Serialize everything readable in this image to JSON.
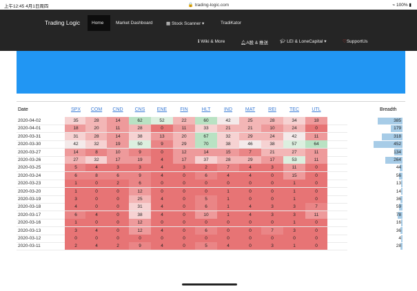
{
  "status_bar": {
    "time": "上午12:45",
    "date": "4月1日周四",
    "url": "trading-logic.com",
    "battery": "100%"
  },
  "nav": {
    "brand": "Trading Logic",
    "items": [
      "Home",
      "Market Dashboard",
      "Stock Scanner ▾",
      "TradiKator"
    ],
    "items_row2": [
      "Wiki & More",
      "A股 & 推送",
      "LEI & LoneCapital ▾",
      "SupportUs"
    ],
    "icons": [
      "grid-icon",
      "info-icon",
      "bell-icon",
      "graduation-cap-icon",
      "heart-icon"
    ]
  },
  "table": {
    "date_header": "Date",
    "sector_headers": [
      "SPX",
      "COM",
      "CND",
      "CNS",
      "ENE",
      "FIN",
      "HLT",
      "IND",
      "MAT",
      "REI",
      "TEC",
      "UTL"
    ],
    "breadth_header": "Breadth",
    "breadth_max": 452,
    "rows": [
      {
        "date": "2020-04-02",
        "values": [
          "35",
          "28",
          "14",
          "62",
          "52",
          "22",
          "60",
          "42",
          "25",
          "28",
          "34",
          "18"
        ],
        "breadth": 385
      },
      {
        "date": "2020-04-01",
        "values": [
          "18",
          "20",
          "11",
          "28",
          "0",
          "11",
          "33",
          "21",
          "21",
          "10",
          "24",
          "0"
        ],
        "breadth": 179
      },
      {
        "date": "2020-03-31",
        "values": [
          "31",
          "28",
          "14",
          "38",
          "13",
          "20",
          "67",
          "32",
          "29",
          "24",
          "42",
          "11"
        ],
        "breadth": 318
      },
      {
        "date": "2020-03-30",
        "values": [
          "42",
          "32",
          "19",
          "50",
          "9",
          "29",
          "70",
          "38",
          "46",
          "38",
          "57",
          "64"
        ],
        "breadth": 452
      },
      {
        "date": "2020-03-27",
        "values": [
          "14",
          "8",
          "10",
          "9",
          "0",
          "12",
          "14",
          "15",
          "7",
          "21",
          "27",
          "11"
        ],
        "breadth": 134
      },
      {
        "date": "2020-03-26",
        "values": [
          "27",
          "32",
          "17",
          "19",
          "4",
          "17",
          "37",
          "28",
          "29",
          "17",
          "53",
          "11"
        ],
        "breadth": 264
      },
      {
        "date": "2020-03-25",
        "values": [
          "5",
          "4",
          "3",
          "3",
          "4",
          "3",
          "2",
          "7",
          "4",
          "3",
          "11",
          "0"
        ],
        "breadth": 44
      },
      {
        "date": "2020-03-24",
        "values": [
          "6",
          "8",
          "6",
          "9",
          "4",
          "0",
          "6",
          "4",
          "4",
          "0",
          "15",
          "0"
        ],
        "breadth": 56
      },
      {
        "date": "2020-03-23",
        "values": [
          "1",
          "0",
          "2",
          "6",
          "0",
          "0",
          "0",
          "0",
          "0",
          "0",
          "1",
          "0"
        ],
        "breadth": 13
      },
      {
        "date": "2020-03-20",
        "values": [
          "1",
          "0",
          "0",
          "12",
          "0",
          "0",
          "0",
          "1",
          "0",
          "0",
          "1",
          "0"
        ],
        "breadth": 14
      },
      {
        "date": "2020-03-19",
        "values": [
          "3",
          "0",
          "0",
          "25",
          "4",
          "0",
          "5",
          "1",
          "0",
          "0",
          "1",
          "0"
        ],
        "breadth": 36
      },
      {
        "date": "2020-03-18",
        "values": [
          "4",
          "0",
          "0",
          "31",
          "4",
          "0",
          "6",
          "1",
          "4",
          "3",
          "3",
          "7"
        ],
        "breadth": 59
      },
      {
        "date": "2020-03-17",
        "values": [
          "6",
          "4",
          "0",
          "38",
          "4",
          "0",
          "10",
          "1",
          "4",
          "3",
          "3",
          "11"
        ],
        "breadth": 78
      },
      {
        "date": "2020-03-16",
        "values": [
          "1",
          "0",
          "0",
          "12",
          "0",
          "0",
          "0",
          "0",
          "0",
          "0",
          "1",
          "0"
        ],
        "breadth": 16
      },
      {
        "date": "2020-03-13",
        "values": [
          "3",
          "4",
          "0",
          "12",
          "4",
          "0",
          "6",
          "0",
          "0",
          "7",
          "3",
          "0"
        ],
        "breadth": 36
      },
      {
        "date": "2020-03-12",
        "values": [
          "0",
          "0",
          "0",
          "0",
          "0",
          "0",
          "0",
          "0",
          "0",
          "0",
          "0",
          "0"
        ],
        "breadth": 4
      },
      {
        "date": "2020-03-11",
        "values": [
          "2",
          "4",
          "2",
          "9",
          "4",
          "0",
          "5",
          "4",
          "0",
          "3",
          "1",
          "0"
        ],
        "breadth": 28
      }
    ]
  },
  "colors": {
    "nav_bg": "#252525",
    "banner_blue": "#2196f3",
    "link_blue": "#3a7bd5",
    "breadth_bar": "#a7cce7"
  }
}
